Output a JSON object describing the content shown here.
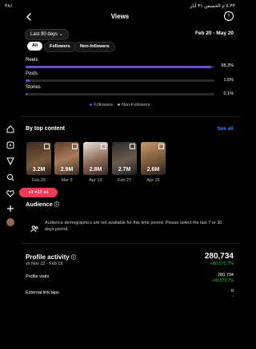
{
  "status": {
    "time": "٤:٣٣ م الخميس ٣١ آيار",
    "battery": "٣٨٪"
  },
  "header": {
    "title": "Views",
    "back_icon": "chevron-left-icon",
    "info_icon": "info-icon"
  },
  "range": {
    "label": "Last 90 days",
    "dates": "Feb 20 - May 20"
  },
  "filters": [
    "All",
    "Followers",
    "Non-followers"
  ],
  "content_types": [
    {
      "label": "Reels",
      "percent": "98.3%",
      "fraction": 0.983
    },
    {
      "label": "Posts",
      "percent": "1.5%",
      "fraction": 0.015
    },
    {
      "label": "Stories",
      "percent": "0.1%",
      "fraction": 0.001
    }
  ],
  "legend": {
    "followers": "Followers",
    "non_followers": "Non-Followers",
    "followers_color": "#7c3aed",
    "non_followers_color": "#9ca3af"
  },
  "top_content": {
    "title": "By top content",
    "see_all": "See all",
    "items": [
      {
        "count": "3.2M",
        "date": "Feb 25"
      },
      {
        "count": "2.9M",
        "date": "Mar 9"
      },
      {
        "count": "2.8M",
        "date": "Apr 13"
      },
      {
        "count": "2.7M",
        "date": "Feb 27"
      },
      {
        "count": "2.6M",
        "date": "Apr 15"
      }
    ]
  },
  "notifications": {
    "a": "1",
    "b": "17",
    "c": "1"
  },
  "audience": {
    "title": "Audience",
    "message": "Audience demographics are not available for this time period. Please select the last 7 or 30 days period."
  },
  "profile_activity": {
    "title": "Profile activity",
    "comparison": "vs Nov 22 - Feb 19",
    "total": "280,734",
    "total_change": "+80,570.7%",
    "visits_label": "Profile visits",
    "visits": "280,734",
    "visits_change": "+80,570.7%",
    "taps_label": "External link taps",
    "taps": "0",
    "taps_change": "-"
  }
}
